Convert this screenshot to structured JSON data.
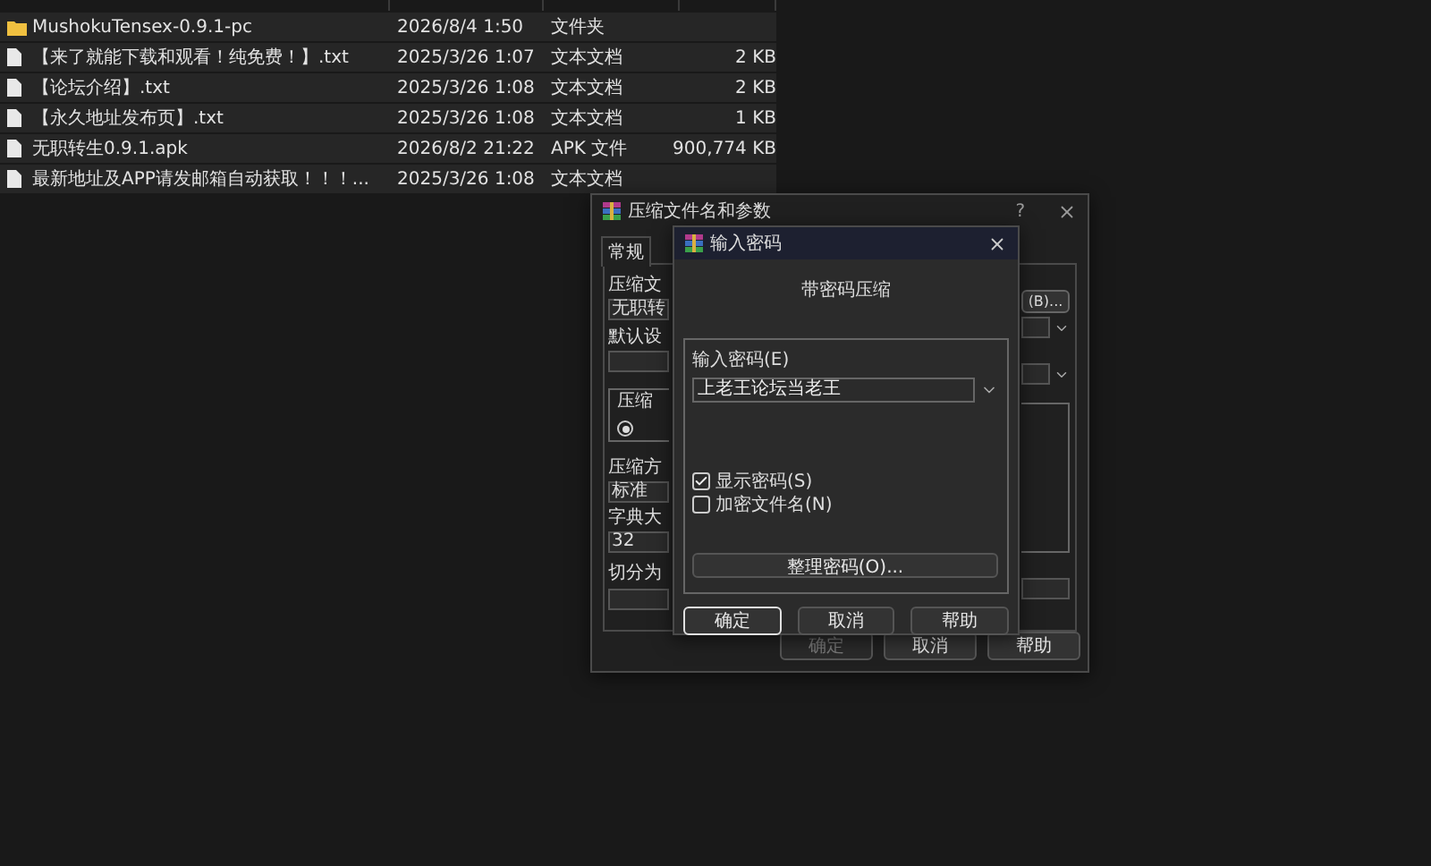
{
  "files": [
    {
      "kind": "folder",
      "name": "MushokuTensex-0.9.1-pc",
      "date": "2026/8/4 1:50",
      "type": "文件夹"
    },
    {
      "kind": "document",
      "name": "【来了就能下载和观看！纯免费！】.txt",
      "date": "2025/3/26 1:07",
      "type": "文本文档",
      "size": "2 KB"
    },
    {
      "kind": "document",
      "name": "【论坛介绍】.txt",
      "date": "2025/3/26 1:08",
      "type": "文本文档",
      "size": "2 KB"
    },
    {
      "kind": "document",
      "name": "【永久地址发布页】.txt",
      "date": "2025/3/26 1:08",
      "type": "文本文档",
      "size": "1 KB"
    },
    {
      "kind": "document",
      "name": "无职转生0.9.1.apk",
      "date": "2026/8/2 21:22",
      "type": "APK 文件",
      "size": "900,774 KB"
    },
    {
      "kind": "document",
      "name": "最新地址及APP请发邮箱自动获取！！！...",
      "date": "2025/3/26 1:08",
      "type": "文本文档"
    }
  ],
  "archive_dialog": {
    "title": "压缩文件名和参数",
    "help": "?",
    "tabs": [
      {
        "label": "常规",
        "selected": true
      }
    ],
    "archive_label": "压缩文",
    "archive_value": "无职转",
    "browse_button": "(B)...",
    "profile_label": "默认设",
    "group_label": "压缩",
    "group_radio_selected": true,
    "method_label": "压缩方",
    "method_value": "标准",
    "dict_label": "字典大",
    "dict_value": "32",
    "split_label": "切分为",
    "buttons": [
      {
        "label": "确定",
        "disabled": true
      },
      {
        "label": "取消",
        "disabled": false
      },
      {
        "label": "帮助",
        "disabled": false
      }
    ]
  },
  "password_dialog": {
    "title": "输入密码",
    "heading": "带密码压缩",
    "password_label": "输入密码(E)",
    "password_value": "上老王论坛当老王",
    "options": [
      {
        "label": "显示密码(S)",
        "checked": true
      },
      {
        "label": "加密文件名(N)",
        "checked": false
      }
    ],
    "organize_button": "整理密码(O)...",
    "buttons": [
      {
        "label": "确定",
        "focused": true
      },
      {
        "label": "取消",
        "focused": false
      },
      {
        "label": "帮助",
        "focused": false
      }
    ]
  }
}
